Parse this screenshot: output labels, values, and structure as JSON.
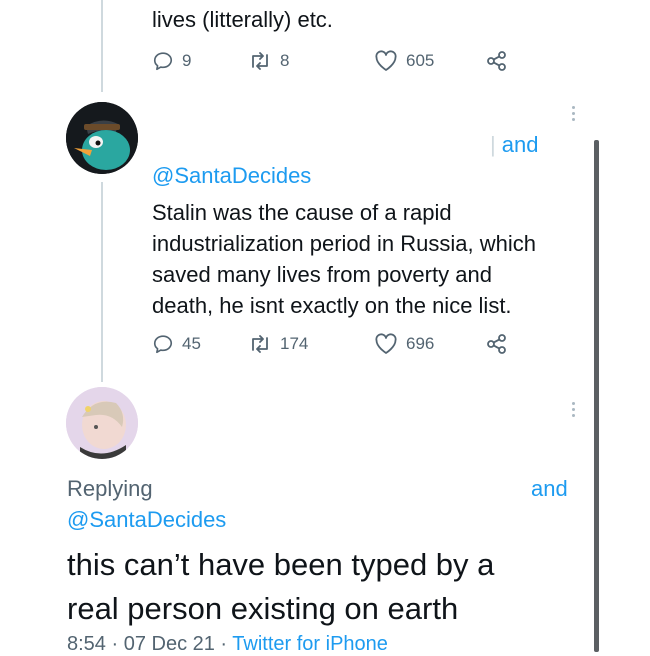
{
  "tweet1": {
    "text_tail": "lives (litterally) etc.",
    "replies": "9",
    "retweets": "8",
    "likes": "605"
  },
  "tweet2": {
    "replying_fragment": "and",
    "handle": "@SantaDecides",
    "text": "Stalin was the cause of a rapid industrialization period in Russia, which saved many lives from poverty and death, he isnt exactly on the nice list.",
    "lines": [
      "Stalin was the cause of a rapid",
      "industrialization period in Russia, which",
      "saved many lives from poverty and",
      "death, he isnt exactly on the nice list."
    ],
    "replies": "45",
    "retweets": "174",
    "likes": "696"
  },
  "tweet3": {
    "replying_label": "Replying",
    "replying_fragment": "and",
    "handle": "@SantaDecides",
    "lines": [
      "this can’t have been typed by a",
      "real person existing on earth"
    ],
    "meta": "8:54 · 07 Dec 21 · ",
    "source": "Twitter for iPhone"
  },
  "colors": {
    "accent": "#1d9bf0",
    "secondary_text": "#536471",
    "primary_text": "#0f1419"
  },
  "icons": [
    "reply-icon",
    "retweet-icon",
    "like-icon",
    "share-icon",
    "more-icon"
  ]
}
